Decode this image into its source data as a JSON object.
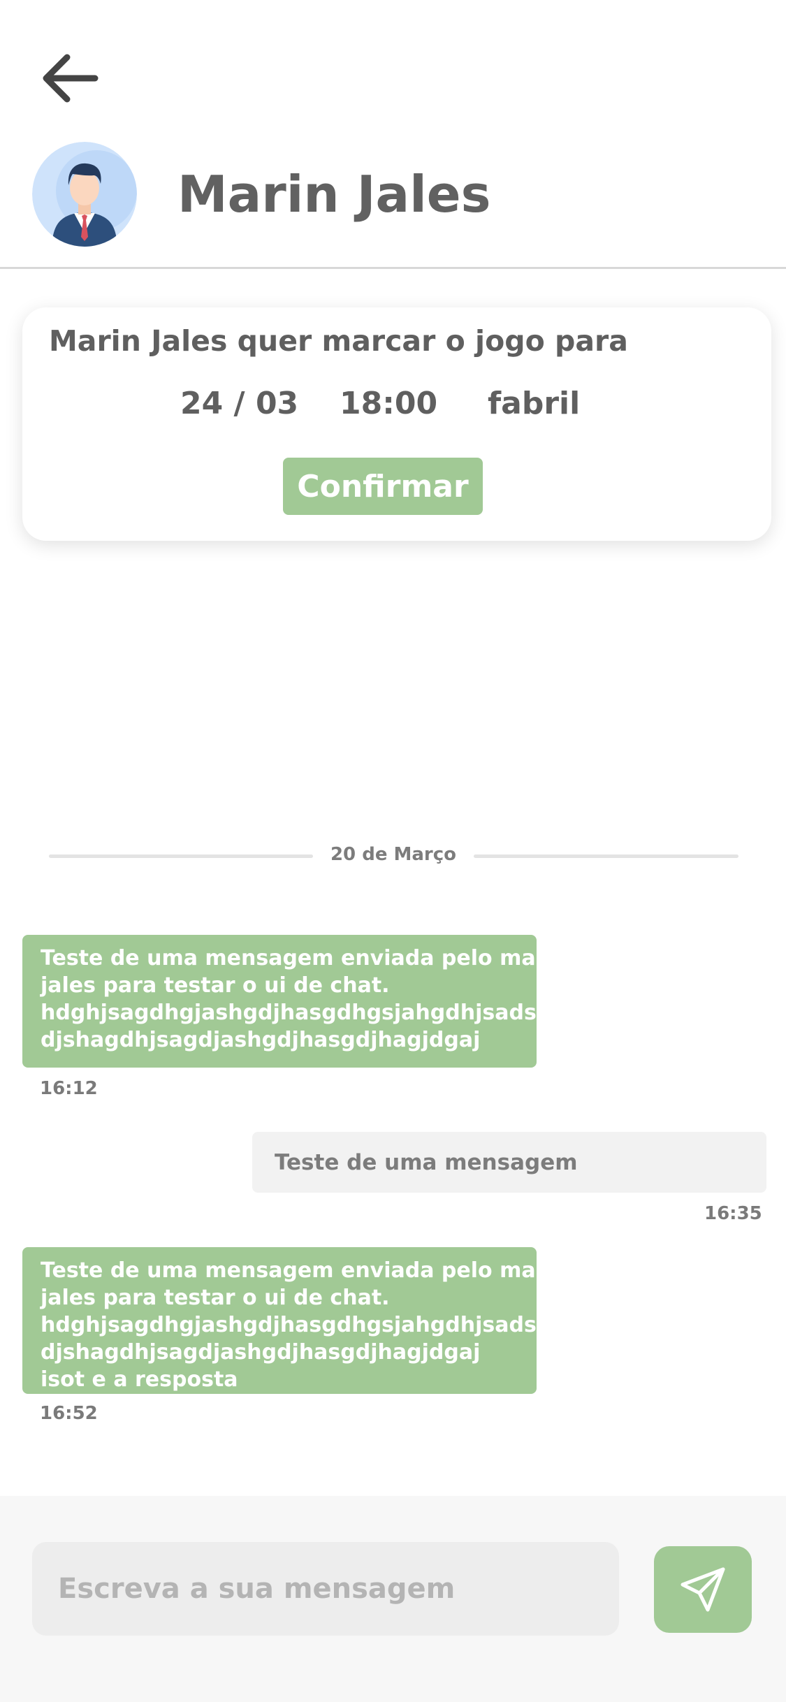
{
  "header": {
    "back_icon": "arrow-left-icon",
    "avatar_icon": "businessman-avatar",
    "contact_name": "Marin Jales"
  },
  "invite": {
    "text": "Marin Jales quer marcar o jogo para",
    "date": "24 / 03",
    "time": "18:00",
    "place": "fabril",
    "confirm_label": "Confirmar"
  },
  "chat": {
    "date_separator": "20 de Março",
    "messages": [
      {
        "direction": "incoming",
        "lines": [
          "Teste de uma mensagem enviada pelo marin",
          "jales para testar o ui de chat.",
          "hdghjsagdhgjashgdjhasgdhgsjahgdhjsadsa",
          "djshagdhjsagdjashgdjhasgdjhagjdgaj"
        ],
        "time": "16:12"
      },
      {
        "direction": "outgoing",
        "lines": [
          "Teste de uma mensagem"
        ],
        "time": "16:35"
      },
      {
        "direction": "incoming",
        "lines": [
          "Teste de uma mensagem enviada pelo marin",
          "jales para testar o ui de chat.",
          "hdghjsagdhgjashgdjhasgdhgsjahgdhjsadsa",
          "djshagdhjsagdjashgdjhasgdjhagjdgaj",
          "isot e a resposta"
        ],
        "time": "16:52"
      }
    ]
  },
  "composer": {
    "placeholder": "Escreva a sua mensagem",
    "value": "",
    "send_icon": "paper-plane-icon"
  },
  "colors": {
    "accent_green": "#a1c995",
    "text_gray": "#616161",
    "outgoing_bubble": "#f2f2f2"
  }
}
